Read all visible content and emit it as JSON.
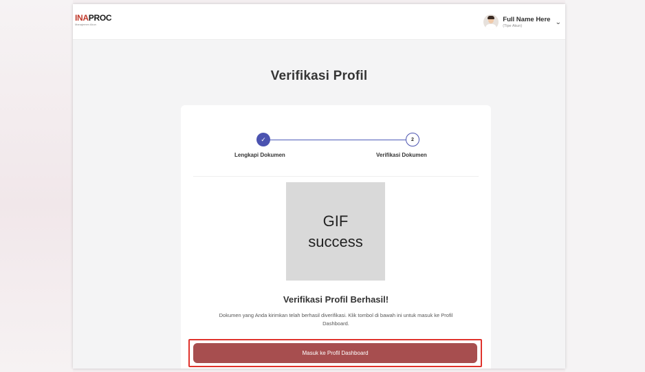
{
  "app": {
    "logo_main_accent": "INA",
    "logo_main_rest": "PROC",
    "logo_sub": "Manajemen Akun"
  },
  "user": {
    "name": "Full Name Here",
    "role": "(Tipe Akun)",
    "menu_icon": "chevron-down-icon"
  },
  "page": {
    "title": "Verifikasi Profil"
  },
  "stepper": {
    "steps": [
      {
        "label": "Lengkapi Dokumen",
        "status": "completed",
        "marker": "✓"
      },
      {
        "label": "Verifikasi Dokumen",
        "status": "active",
        "marker": "2"
      }
    ],
    "accent_color": "#4b53b0"
  },
  "result": {
    "placeholder_line1": "GIF",
    "placeholder_line2": "success",
    "title": "Verifikasi Profil Berhasil!",
    "description": "Dokumen yang Anda kirimkan telah berhasil diverifikasi. Klik tombol di bawah ini untuk masuk ke Profil Dashboard.",
    "button_label": "Masuk ke Profil Dashboard",
    "button_color": "#a74e4f",
    "highlight_color": "#e0322c"
  }
}
